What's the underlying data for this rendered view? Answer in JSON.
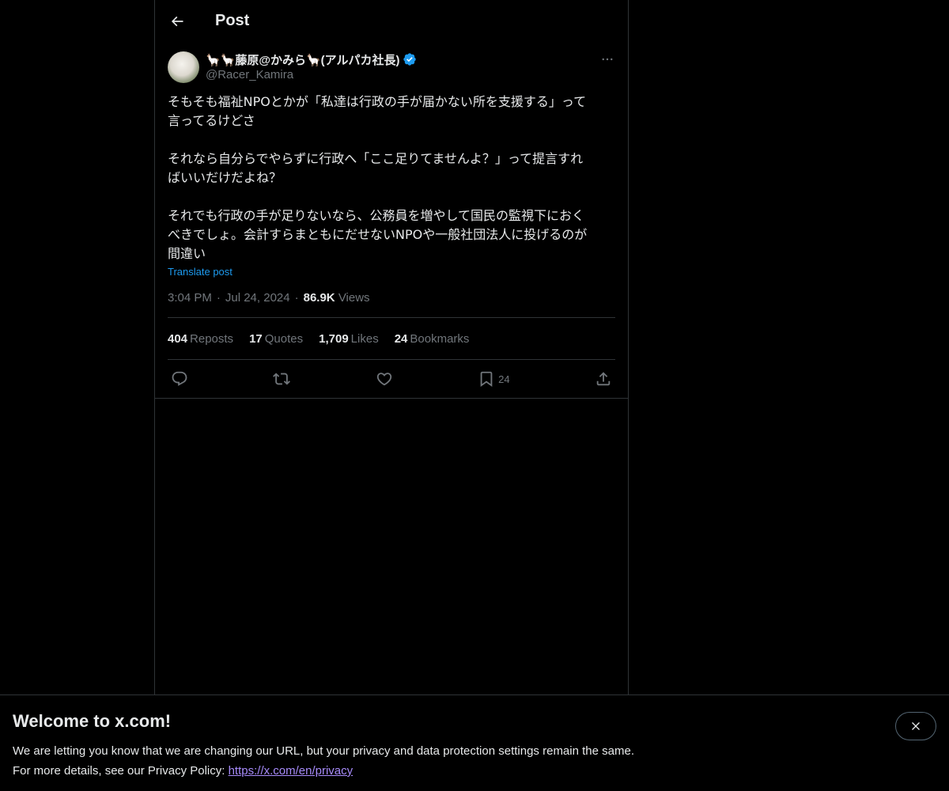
{
  "header": {
    "title": "Post",
    "back_icon": "arrow-left-icon"
  },
  "post": {
    "display_name": "🦙🦙藤原@かみら🦙(アルパカ社長)",
    "handle": "@Racer_Kamira",
    "verified_color": "#1d9bf0",
    "text": "そもそも福祉NPOとかが「私達は行政の手が届かない所を支援する」って\n言ってるけどさ\n\nそれなら自分らでやらずに行政へ「ここ足りてませんよ？」って提言すれ\nばいいだけだよね？\n\nそれでも行政の手が足りないなら、公務員を増やして国民の監視下におく\nべきでしょ。会計すらまともにだせないNPOや一般社団法人に投げるのが\n間違い",
    "translate_label": "Translate post",
    "time": "3:04 PM",
    "date": "Jul 24, 2024",
    "views_count": "86.9K",
    "views_label": "Views",
    "stats": {
      "reposts_count": "404",
      "reposts_label": "Reposts",
      "quotes_count": "17",
      "quotes_label": "Quotes",
      "likes_count": "1,709",
      "likes_label": "Likes",
      "bookmarks_count": "24",
      "bookmarks_label": "Bookmarks"
    },
    "actions": {
      "bookmark_count": "24"
    }
  },
  "banner": {
    "title": "Welcome to x.com!",
    "line1": "We are letting you know that we are changing our URL, but your privacy and data protection settings remain the same.",
    "line2_prefix": "For more details, see our Privacy Policy: ",
    "link": "https://x.com/en/privacy"
  },
  "colors": {
    "accent": "#1d9bf0",
    "link": "#a78bfa",
    "background": "#000000"
  }
}
